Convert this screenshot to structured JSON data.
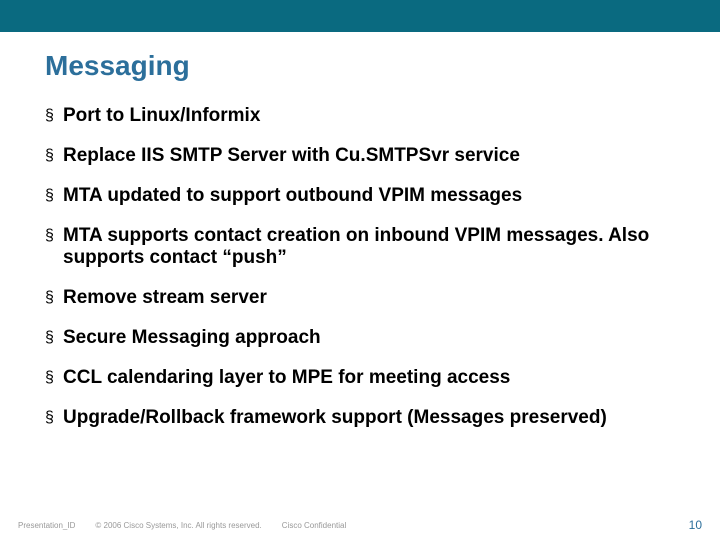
{
  "title": "Messaging",
  "bullets": [
    "Port to Linux/Informix",
    "Replace IIS SMTP Server with Cu.SMTPSvr service",
    "MTA updated to support outbound VPIM messages",
    "MTA supports contact creation on inbound VPIM messages.  Also supports contact “push”",
    "Remove stream server",
    "Secure Messaging approach",
    "CCL calendaring layer to MPE for meeting access",
    "Upgrade/Rollback framework support (Messages preserved)"
  ],
  "bullet_char": "§",
  "footer": {
    "presentation_id": "Presentation_ID",
    "copyright": "© 2006 Cisco Systems, Inc. All rights reserved.",
    "confidential": "Cisco Confidential",
    "page_num": "10"
  }
}
